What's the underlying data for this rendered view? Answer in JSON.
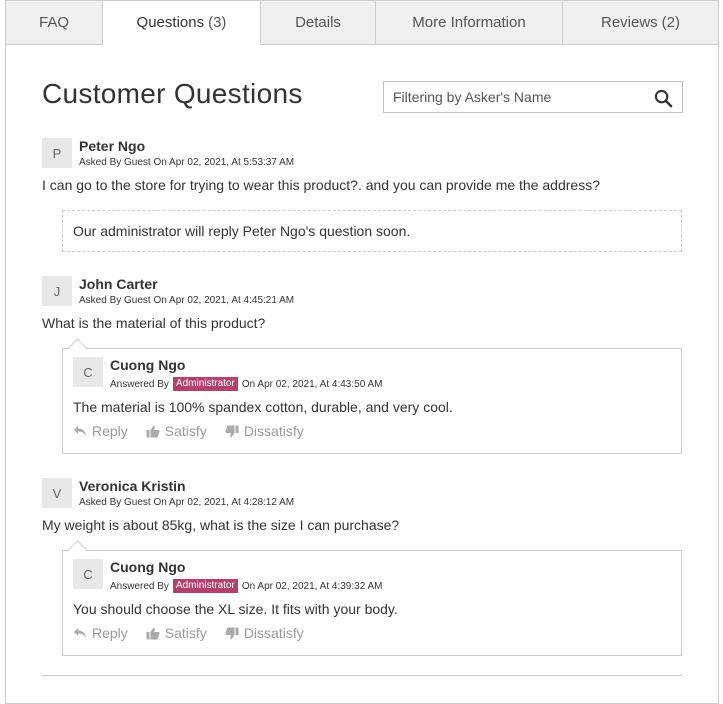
{
  "tabs": [
    {
      "label": "FAQ",
      "count": ""
    },
    {
      "label": "Questions",
      "count": "(3)"
    },
    {
      "label": "Details",
      "count": ""
    },
    {
      "label": "More Information",
      "count": ""
    },
    {
      "label": "Reviews",
      "count": "(2)"
    }
  ],
  "active_tab": "Questions",
  "section_title": "Customer Questions",
  "filter": {
    "placeholder": "Filtering by Asker's Name",
    "icon": "search-icon"
  },
  "questions": [
    {
      "initial": "P",
      "name": "Peter Ngo",
      "meta": "Asked By Guest On Apr 02, 2021, At 5:53:37 AM",
      "text": "I can go to the store for trying to wear this product?. and you can provide me the address?",
      "pending_reply": "Our administrator will reply Peter Ngo's question soon."
    },
    {
      "initial": "J",
      "name": "John Carter",
      "meta": "Asked By Guest On Apr 02, 2021, At 4:45:21 AM",
      "text": "What is the material of this product?",
      "answer": {
        "initial": "C",
        "name": "Cuong Ngo",
        "answered_by": "Answered By",
        "role": "Administrator",
        "date": "On Apr 02, 2021, At 4:43:50 AM",
        "text": "The material is 100% spandex cotton, durable, and very cool."
      }
    },
    {
      "initial": "V",
      "name": "Veronica Kristin",
      "meta": "Asked By Guest On Apr 02, 2021, At 4:28:12 AM",
      "text": "My weight is about 85kg, what is the size I can purchase?",
      "answer": {
        "initial": "C",
        "name": "Cuong Ngo",
        "answered_by": "Answered By",
        "role": "Administrator",
        "date": "On Apr 02, 2021, At 4:39:32 AM",
        "text": "You should choose the XL size. It fits with your body."
      }
    }
  ],
  "actions": {
    "reply": "Reply",
    "satisfy": "Satisfy",
    "dissatisfy": "Dissatisfy"
  },
  "colors": {
    "badge": "#b3416b",
    "border": "#cccccc",
    "muted": "#999999"
  }
}
